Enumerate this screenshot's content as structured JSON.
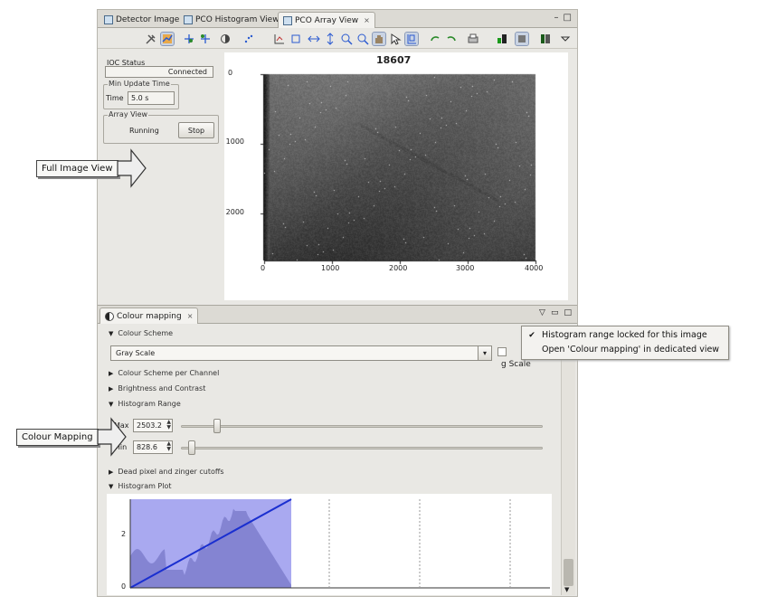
{
  "tabs": [
    {
      "label": "Detector Image",
      "active": false
    },
    {
      "label": "PCO Histogram View",
      "active": false
    },
    {
      "label": "PCO Array View",
      "active": true,
      "close": "×"
    }
  ],
  "window_controls": {
    "minimize": "–",
    "maximize": "□"
  },
  "ioc": {
    "status_label": "IOC Status",
    "status_value": "Connected",
    "min_update_label": "Min Update Time",
    "time_label": "Time",
    "time_value": "5.0 s",
    "array_view_label": "Array View",
    "array_view_state": "Running",
    "stop_button": "Stop"
  },
  "image_plot": {
    "title": "18607",
    "x_ticks": [
      "0",
      "1000",
      "2000",
      "3000",
      "4000"
    ],
    "y_ticks": [
      "0",
      "1000",
      "2000"
    ]
  },
  "colour_mapping": {
    "tab_label": "Colour mapping",
    "tab_close": "×",
    "sections": {
      "scheme": "Colour Scheme",
      "scheme_per_channel": "Colour Scheme per Channel",
      "brightness": "Brightness and Contrast",
      "histogram_range": "Histogram Range",
      "dead_pixel": "Dead pixel and zinger cutoffs",
      "histogram_plot": "Histogram Plot"
    },
    "scheme_value": "Gray Scale",
    "log_scale_partial": "g Scale",
    "max_label": "Max",
    "max_value": "2503.2",
    "min_label": "Min",
    "min_value": "828.6",
    "max_slider_fraction": 0.09,
    "min_slider_fraction": 0.02,
    "histogram_y_ticks": [
      "2",
      "0"
    ]
  },
  "popup_menu": {
    "items": [
      {
        "label": "Histogram range locked for this image",
        "checked": true
      },
      {
        "label": "Open 'Colour mapping' in dedicated view",
        "checked": false
      }
    ]
  },
  "callouts": {
    "full_image": "Full Image View",
    "colour_mapping": "Colour Mapping"
  },
  "colors": {
    "histogram_fill": "#a9a9f0",
    "histogram_line": "#1a2fd0",
    "histogram_bars": "#7b7bcb"
  }
}
